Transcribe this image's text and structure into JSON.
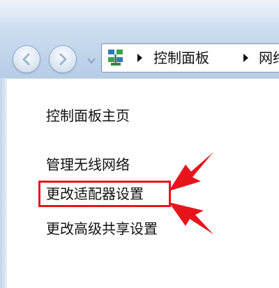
{
  "address_bar": {
    "breadcrumbs": [
      "控制面板",
      "网络"
    ]
  },
  "nav_pane": {
    "links": [
      {
        "label": "控制面板主页"
      },
      {
        "label": "管理无线网络"
      },
      {
        "label": "更改适配器设置"
      },
      {
        "label": "更改高级共享设置"
      }
    ]
  },
  "colors": {
    "annotation": "#e8141c",
    "frame": "#c9dbee"
  },
  "icons": {
    "back": "back-arrow-icon",
    "forward": "forward-arrow-icon",
    "recent": "chevron-down-icon",
    "location": "network-icon",
    "separator": "breadcrumb-separator-icon"
  }
}
